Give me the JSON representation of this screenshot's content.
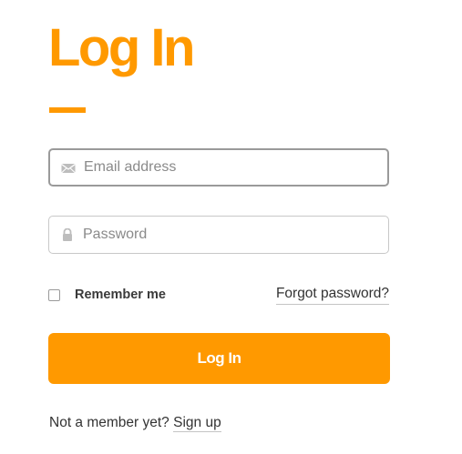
{
  "page": {
    "title": "Log In",
    "accent_color": "#ff9900"
  },
  "form": {
    "email": {
      "placeholder": "Email address",
      "value": "",
      "icon": "envelope-icon"
    },
    "password": {
      "placeholder": "Password",
      "value": "",
      "icon": "lock-icon"
    },
    "remember_me": {
      "label": "Remember me",
      "checked": false
    },
    "forgot_password_label": "Forgot password?",
    "submit_label": "Log In"
  },
  "footer": {
    "prompt": "Not a member yet?",
    "signup_label": "Sign up"
  }
}
